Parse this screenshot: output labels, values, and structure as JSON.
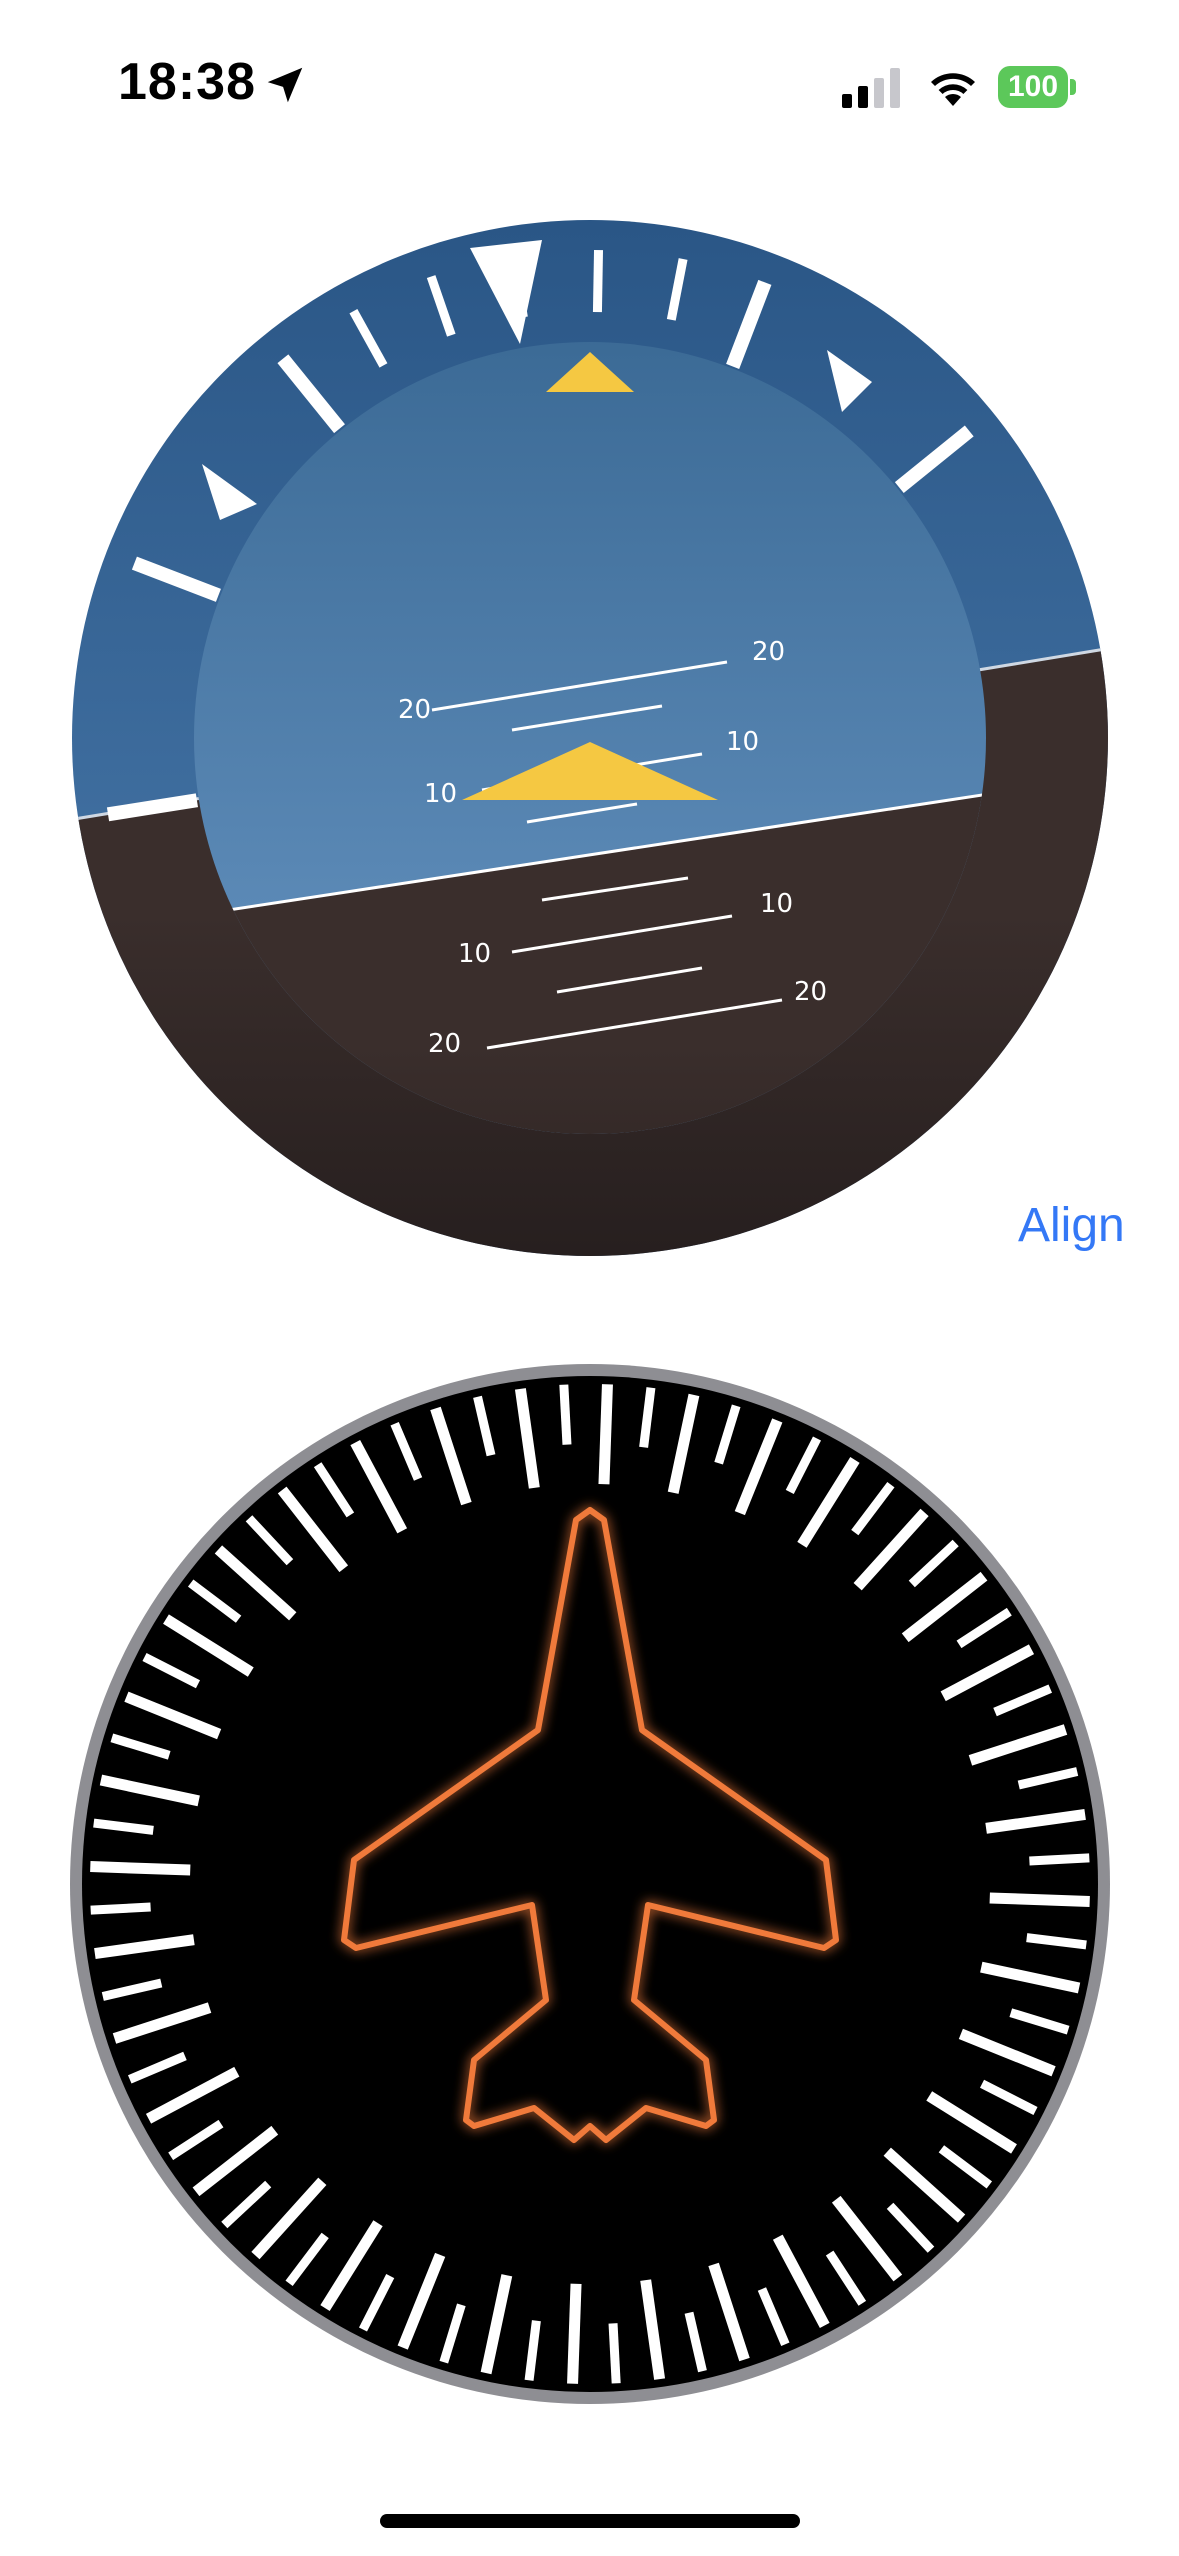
{
  "status_bar": {
    "time": "18:38",
    "battery_level": "100",
    "icons": [
      "location-arrow-icon",
      "cellular-signal-icon",
      "wifi-icon",
      "battery-icon"
    ],
    "battery_color": "#5cc85a"
  },
  "attitude_indicator": {
    "pitch_labels": {
      "up_20": "20",
      "up_10": "10",
      "down_10": "10",
      "down_20": "20"
    },
    "colors": {
      "sky": "#2f5f8f",
      "ground": "#3a2e2c",
      "aircraft_symbol": "#f5c842",
      "tick_marks": "#ffffff"
    }
  },
  "align_button": {
    "label": "Align"
  },
  "heading_indicator": {
    "colors": {
      "face": "#000000",
      "bezel": "#8e8e93",
      "airplane": "#f07a3a",
      "tick_marks": "#ffffff"
    },
    "icon": "airplane-icon"
  }
}
